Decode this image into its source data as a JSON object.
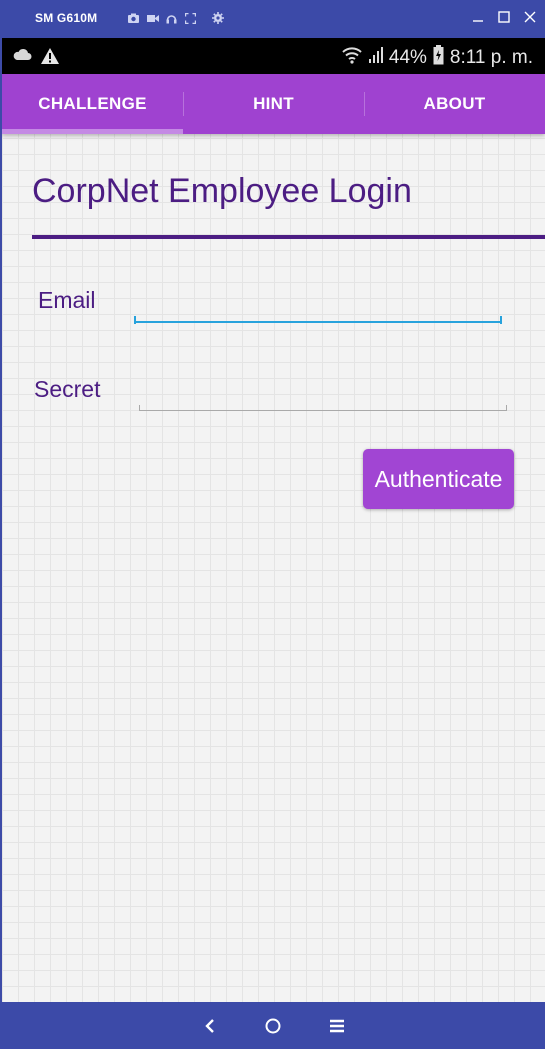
{
  "window": {
    "title": "SM G610M",
    "tools": [
      "camera-icon",
      "video-icon",
      "headphones-icon",
      "fullscreen-icon",
      "settings-icon"
    ],
    "controls": {
      "minimize": "minimize-icon",
      "maximize": "maximize-icon",
      "close": "close-icon"
    }
  },
  "status": {
    "left_icons": [
      "cloud-icon",
      "warning-icon"
    ],
    "battery": "44%",
    "time": "8:11 p. m."
  },
  "tabs": [
    {
      "label": "CHALLENGE",
      "selected": true
    },
    {
      "label": "HINT",
      "selected": false
    },
    {
      "label": "ABOUT",
      "selected": false
    }
  ],
  "page": {
    "title": "CorpNet Employee Login"
  },
  "form": {
    "email_label": "Email",
    "email_value": "",
    "secret_label": "Secret",
    "secret_value": "",
    "submit_label": "Authenticate"
  },
  "nav": [
    "back-icon",
    "home-icon",
    "recents-icon"
  ],
  "colors": {
    "accent": "#a145d3",
    "tab_bar": "#9f42d0",
    "title_text": "#4c1d83",
    "focus_line": "#27a2dc",
    "frame": "#3c4aa8"
  }
}
